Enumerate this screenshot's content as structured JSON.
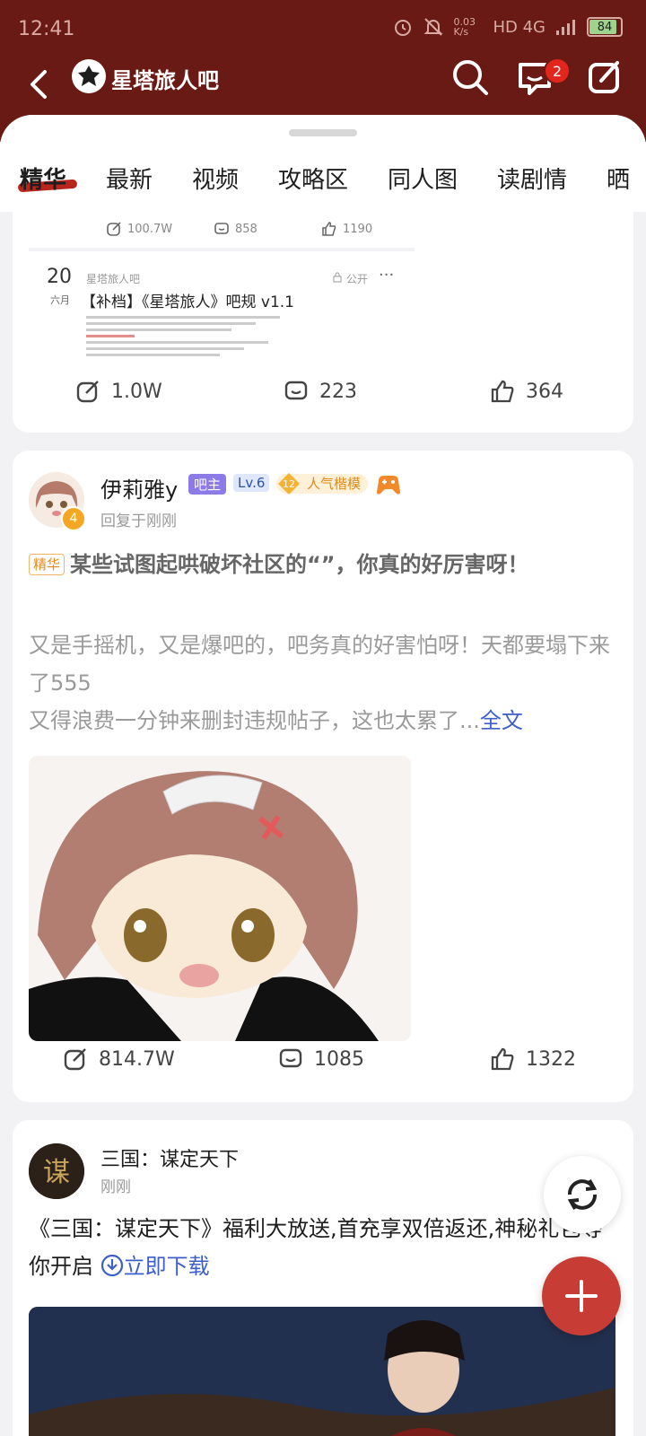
{
  "status_bar": {
    "time": "12:41",
    "speed": "0.03 K/s",
    "network": "HD 4G",
    "battery": "84"
  },
  "header": {
    "title": "星塔旅人吧",
    "message_badge": "2"
  },
  "tabs": [
    {
      "label": "精华"
    },
    {
      "label": "最新"
    },
    {
      "label": "视频"
    },
    {
      "label": "攻略区"
    },
    {
      "label": "同人图"
    },
    {
      "label": "读剧情"
    },
    {
      "label": "晒"
    }
  ],
  "embedded_post": {
    "views": "100.7W",
    "comments": "858",
    "likes": "1190",
    "date_day": "20",
    "date_month": "六月",
    "forum": "星塔旅人吧",
    "visibility": "公开",
    "title": "【补档】《星塔旅人》吧规 v1.1"
  },
  "post1_stats": {
    "views": "1.0W",
    "comments": "223",
    "likes": "364"
  },
  "post2": {
    "author": "伊莉雅y",
    "owner_tag": "吧主",
    "level": "Lv.6",
    "popularity_level": "12",
    "popularity_label": "人气楷模",
    "avatar_badge": "4",
    "reply_time": "回复于刚刚",
    "essence_tag": "精华",
    "title": "某些试图起哄破坏社区的“”，你真的好厉害呀！",
    "body_1": "又是手摇机，又是爆吧的，吧务真的好害怕呀！天都要塌下来了555",
    "body_2": "又得浪费一分钟来删封违规帖子，这也太累了...",
    "full_text": "全文",
    "views": "814.7W",
    "comments": "1085",
    "likes": "1322"
  },
  "ad": {
    "name": "三国：谋定天下",
    "time": "刚刚",
    "text": "《三国：谋定天下》福利大放送,首充享双倍返还,神秘礼包等你开启",
    "download": "立即下载"
  },
  "colors": {
    "header_bg": "#6a1a14",
    "accent": "#b7251c",
    "link": "#3c5fc9",
    "fab": "#c73c34"
  }
}
